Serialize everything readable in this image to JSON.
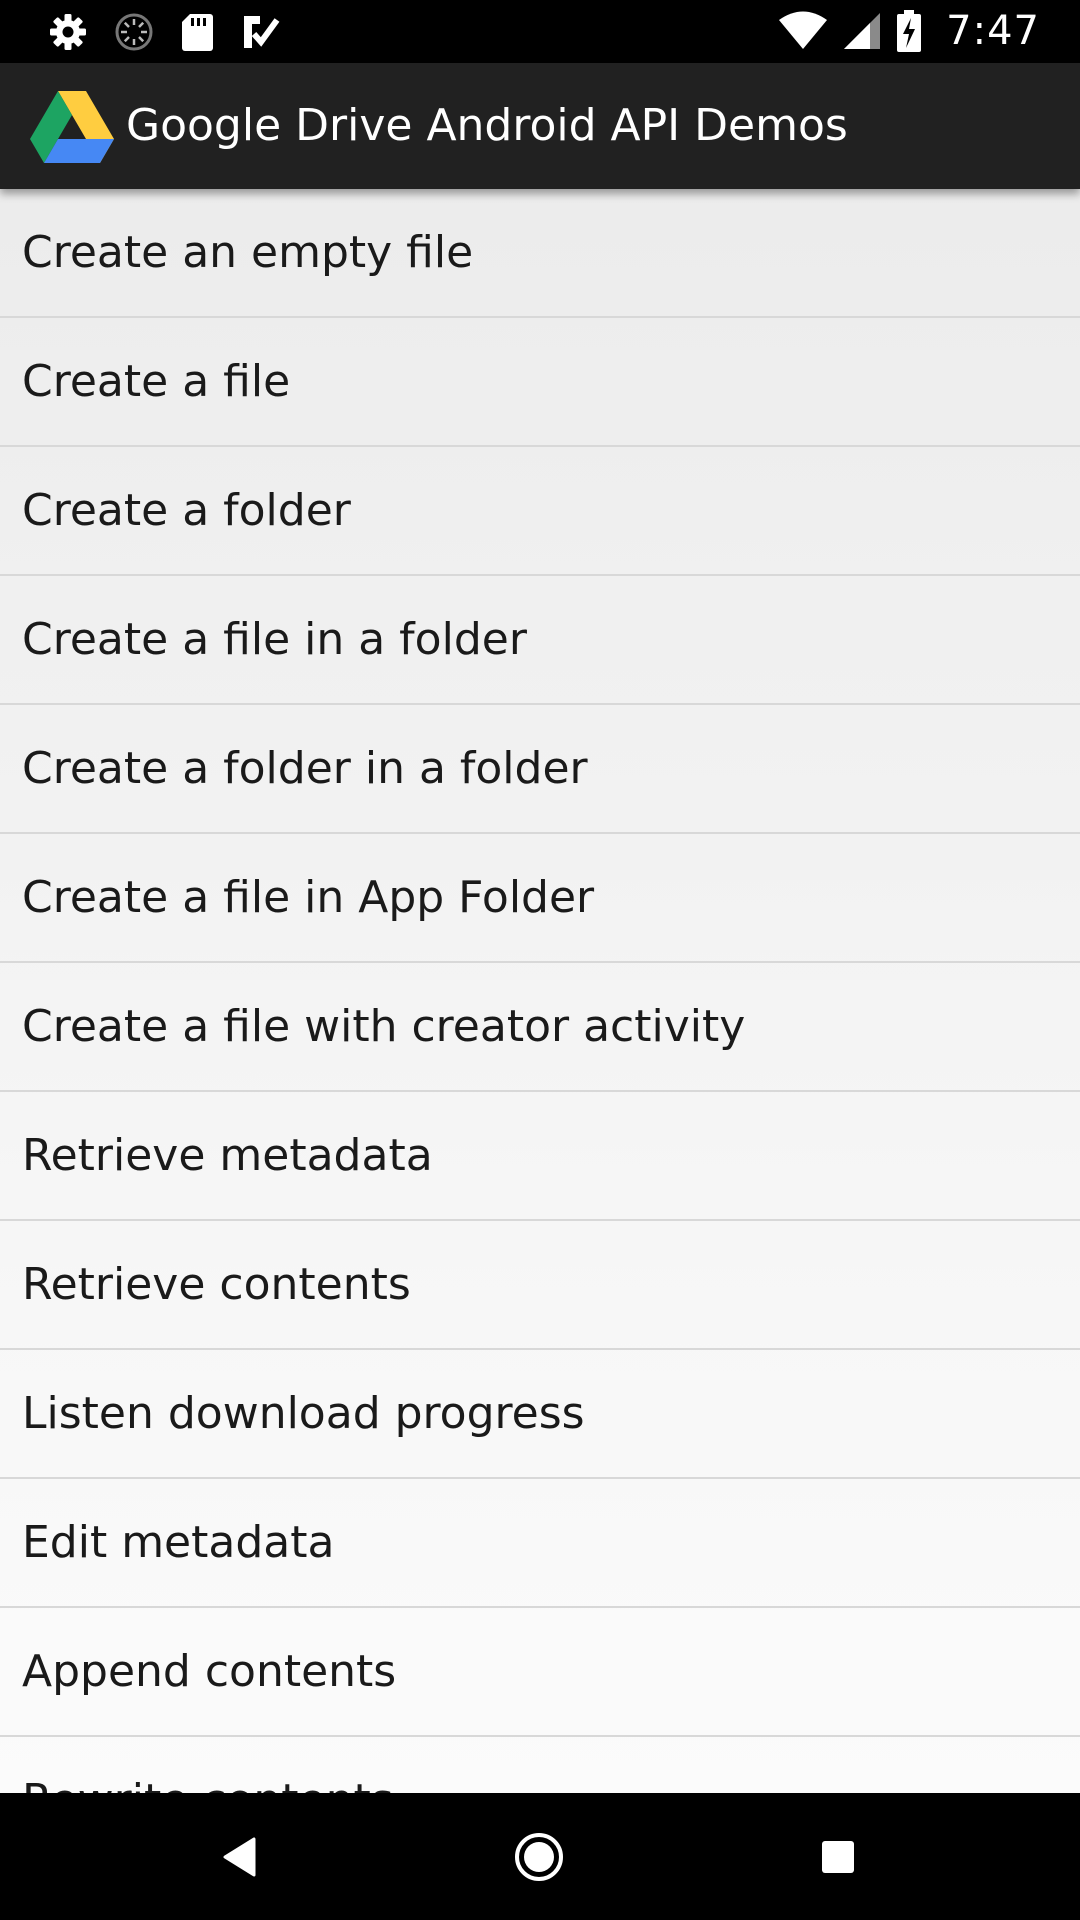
{
  "status_bar": {
    "time": "7:47",
    "left_icons": [
      "settings-icon",
      "sync-spinner-icon",
      "sd-card-icon",
      "checklist-icon"
    ],
    "right_icons": [
      "wifi-icon",
      "cell-signal-icon",
      "battery-charging-icon"
    ]
  },
  "app_bar": {
    "logo_icon": "google-drive-logo",
    "title": "Google Drive Android API Demos",
    "background": "#212121"
  },
  "demos": {
    "items": [
      {
        "label": "Create an empty file"
      },
      {
        "label": "Create a file"
      },
      {
        "label": "Create a folder"
      },
      {
        "label": "Create a file in a folder"
      },
      {
        "label": "Create a folder in a folder"
      },
      {
        "label": "Create a file in App Folder"
      },
      {
        "label": "Create a file with creator activity"
      },
      {
        "label": "Retrieve metadata"
      },
      {
        "label": "Retrieve contents"
      },
      {
        "label": "Listen download progress"
      },
      {
        "label": "Edit metadata"
      },
      {
        "label": "Append contents"
      },
      {
        "label": "Rewrite contents"
      }
    ]
  },
  "nav_bar": {
    "buttons": [
      "back-icon",
      "home-icon",
      "recents-icon"
    ]
  },
  "colors": {
    "drive_green": "#1DA462",
    "drive_yellow": "#FFCD40",
    "drive_blue": "#4688F4"
  }
}
